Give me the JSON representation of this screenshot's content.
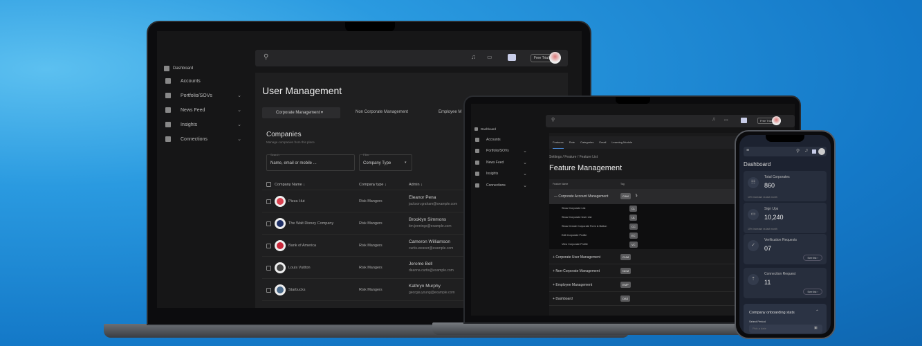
{
  "laptop1": {
    "sidebar": [
      {
        "label": "Dashboard"
      },
      {
        "label": "Accounts"
      },
      {
        "label": "Portfolio/SOVs"
      },
      {
        "label": "News Feed"
      },
      {
        "label": "Insights"
      },
      {
        "label": "Connections"
      }
    ],
    "header": {
      "trial_label": "Free Trial"
    },
    "title": "User Management",
    "tabs": [
      "Corporate Management",
      "Non Corporate Management",
      "Employee M"
    ],
    "section_title": "Companies",
    "section_subtitle": "Manage companies from this place",
    "search": {
      "label": "Search",
      "placeholder": "Name, email or mobile ..."
    },
    "filter": {
      "label": "Filter",
      "value": "Company Type"
    },
    "columns": [
      "Company Name",
      "Company type",
      "Admin"
    ],
    "rows": [
      {
        "name": "Pizza Hut",
        "type": "Risk Mangers",
        "admin": "Eleanor Pena",
        "email": "jackson.graham@example.com",
        "color": "#d9414f"
      },
      {
        "name": "The Walt Disney Company",
        "type": "Risk Mangers",
        "admin": "Brooklyn Simmons",
        "email": "tim.jennings@example.com",
        "color": "#1e2f66"
      },
      {
        "name": "Bank of America",
        "type": "Risk Mangers",
        "admin": "Cameron Williamson",
        "email": "curtis.weaver@example.com",
        "color": "#c8283a"
      },
      {
        "name": "Louis Vuitton",
        "type": "Risk Mangers",
        "admin": "Jerome Bell",
        "email": "deanna.curtis@example.com",
        "color": "#444"
      },
      {
        "name": "Starbucks",
        "type": "Risk Mangers",
        "admin": "Kathryn Murphy",
        "email": "georgia.young@example.com",
        "color": "#4a6a8a"
      }
    ]
  },
  "laptop2": {
    "sidebar": [
      {
        "label": "Dashboard"
      },
      {
        "label": "Accounts"
      },
      {
        "label": "Portfolio/SOVs"
      },
      {
        "label": "News Feed"
      },
      {
        "label": "Insights"
      },
      {
        "label": "Connections"
      }
    ],
    "trial_label": "Free Trial",
    "tabs": [
      "Features",
      "Role",
      "Categories",
      "Email",
      "Learning Module"
    ],
    "breadcrumb": "Settings  /  Feature  /  Feature List",
    "title": "Feature Management",
    "columns": [
      "Feature Name",
      "Tag"
    ],
    "expanded": {
      "name": "Corporate Account Management",
      "tag": "CAM",
      "children": [
        {
          "name": "Show Corporate List",
          "tag": "CL"
        },
        {
          "name": "Show Corporate User List",
          "tag": "UL"
        },
        {
          "name": "Show Create Corporate Form & Button",
          "tag": "CC"
        },
        {
          "name": "Edit Corporate Profile",
          "tag": "EC"
        },
        {
          "name": "View Corporate Profile",
          "tag": "VC"
        }
      ]
    },
    "groups": [
      {
        "name": "Corporate User Management",
        "tag": "CUM"
      },
      {
        "name": "Non-Corporate Management",
        "tag": "NCM"
      },
      {
        "name": "Employee Management",
        "tag": "EMP"
      },
      {
        "name": "Dashboard",
        "tag": "DAS"
      }
    ]
  },
  "phone": {
    "title": "Dashboard",
    "cards": [
      {
        "title": "Total Corporates",
        "value": "860",
        "sub": "10% increase vs last month"
      },
      {
        "title": "Sign Ups",
        "value": "10,240",
        "sub": "10% increase vs last month"
      },
      {
        "title": "Verification Requests",
        "value": "07",
        "button": "See list"
      },
      {
        "title": "Connection Request",
        "value": "11",
        "button": "See list"
      }
    ],
    "stats_title": "Company onboarding stats",
    "period_label": "Select Period",
    "date_placeholder": "Pick a date"
  }
}
